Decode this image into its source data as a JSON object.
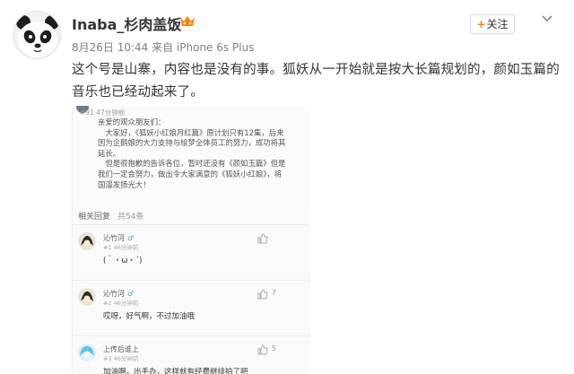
{
  "post": {
    "author": "Inaba_杉肉盖饭",
    "meta": "8月26日 10:44 来自 iPhone 6s Plus",
    "follow_label": "关注",
    "text": "这个号是山寨，内容也是没有的事。狐妖从一开始就是按大长篇规划的，颜如玉篇的音乐也已经动起来了。"
  },
  "screenshot": {
    "notice_topline": "#91    47分钟前",
    "notice_lines": [
      "亲爱的观众朋友们：",
      "　大家好，《狐妖小红娘月红篇》原计划只有12集，后来",
      "因为企鹅娘的大力支持与绘梦全体员工的努力，成功将其",
      "延长。",
      "　但是很抱歉的告诉各位，暂时还没有《颜如玉篇》但是",
      "我们一定会努力，做出令大家满意的《狐妖小红娘》，将",
      "国漫发扬光大！"
    ],
    "related_label": "相关回复",
    "related_count": "共54条",
    "comments": [
      {
        "name": "沁竹河",
        "sex": "♂",
        "floor": "#1    46分钟前",
        "text": "(｀・ω・´)",
        "likes": ""
      },
      {
        "name": "沁竹河",
        "sex": "♂",
        "floor": "#2    46分钟前",
        "text": "哎呀，好气啊，不过加油哦",
        "likes": "7"
      },
      {
        "name": "上传后谁上",
        "sex": "",
        "floor": "#3    46分钟前",
        "text": "加油啊，出手办，这样就有经费继续拍了吧",
        "likes": "5"
      }
    ]
  },
  "colors": {
    "accent": "#ff8200",
    "meta": "#808080",
    "male": "#4aa3df"
  },
  "icons": [
    "vip-badge-icon",
    "chevron-down-icon",
    "plus-icon",
    "thumb-up-icon",
    "panda-avatar-icon"
  ]
}
